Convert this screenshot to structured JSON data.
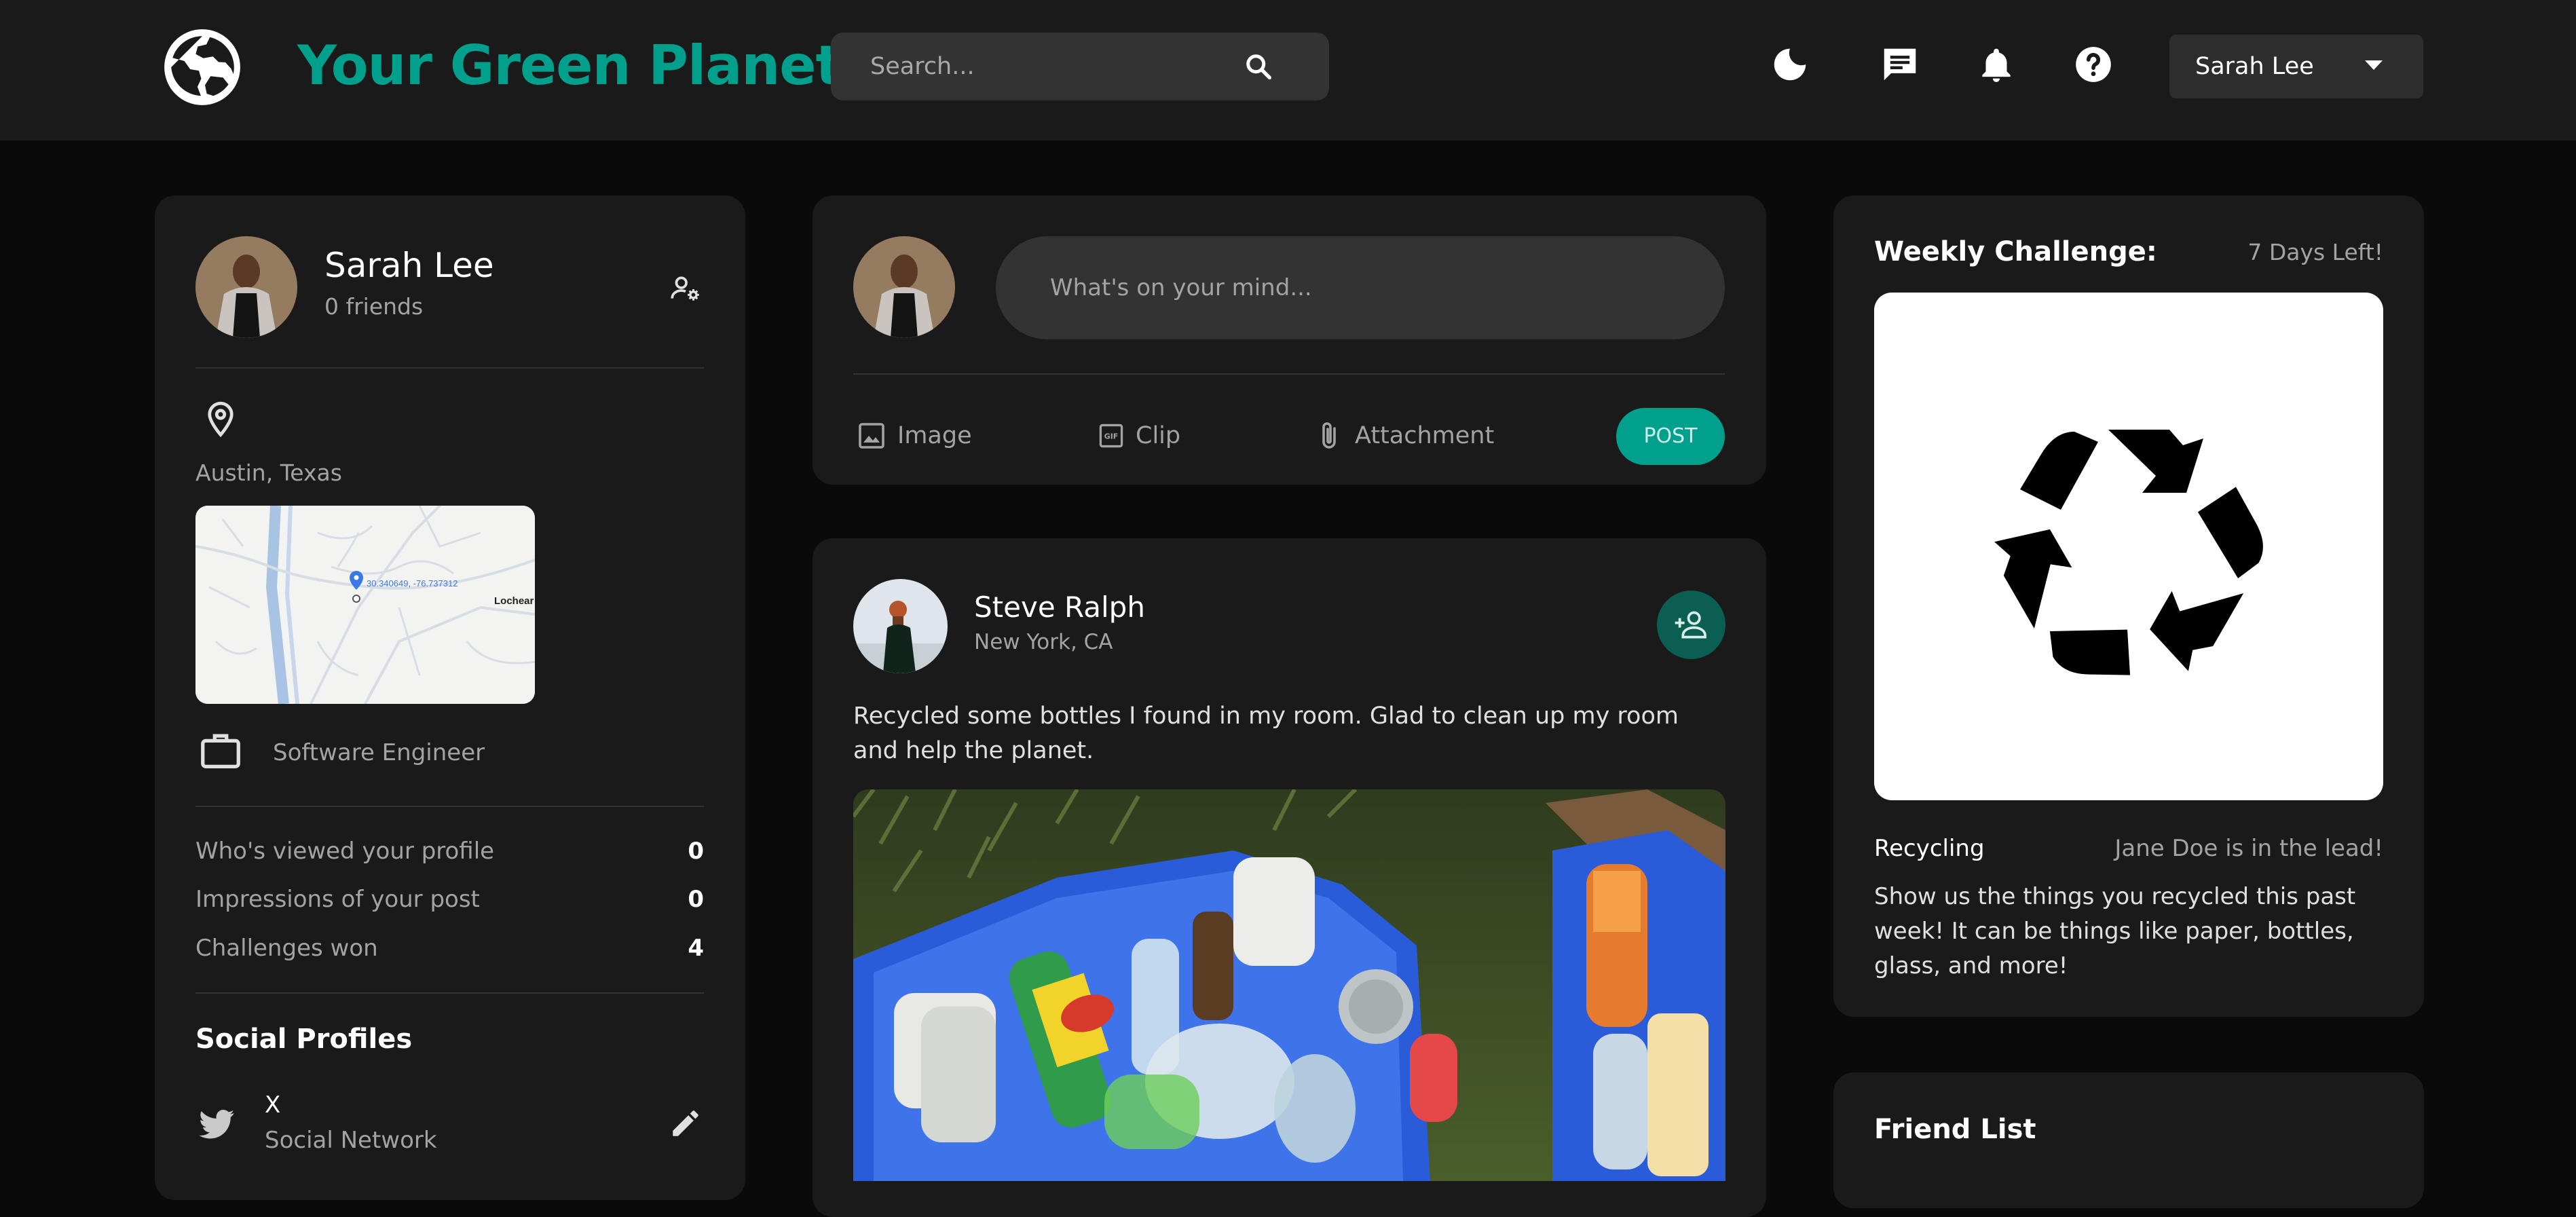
{
  "header": {
    "brand": "Your Green Planet",
    "search_placeholder": "Search...",
    "user_name": "Sarah Lee"
  },
  "profile": {
    "name": "Sarah Lee",
    "friends": "0 friends",
    "location": "Austin, Texas",
    "map_coords": "30.340649, -76.737312",
    "map_place": "Lochear",
    "occupation": "Software Engineer",
    "stats": [
      {
        "label": "Who's viewed your profile",
        "value": "0"
      },
      {
        "label": "Impressions of your post",
        "value": "0"
      },
      {
        "label": "Challenges won",
        "value": "4"
      }
    ],
    "social_title": "Social Profiles",
    "social": [
      {
        "name": "X",
        "sub": "Social Network",
        "icon": "twitter-icon"
      }
    ]
  },
  "composer": {
    "placeholder": "What's on your mind...",
    "actions": {
      "image": "Image",
      "clip": "Clip",
      "attachment": "Attachment"
    },
    "post_label": "POST"
  },
  "feed": {
    "post": {
      "author": "Steve Ralph",
      "location": "New York, CA",
      "text": "Recycled some bottles I found in my room. Glad to clean up my room and help the planet."
    }
  },
  "challenge": {
    "title": "Weekly Challenge:",
    "days_left": "7 Days Left!",
    "category": "Recycling",
    "leader": "Jane Doe is in the lead!",
    "description": "Show us the things you recycled this past week! It can be things like paper, bottles, glass, and more!"
  },
  "friend_list": {
    "title": "Friend List"
  },
  "colors": {
    "accent": "#00a08d",
    "card": "#1a1a1a",
    "background": "#0a0a0a"
  }
}
